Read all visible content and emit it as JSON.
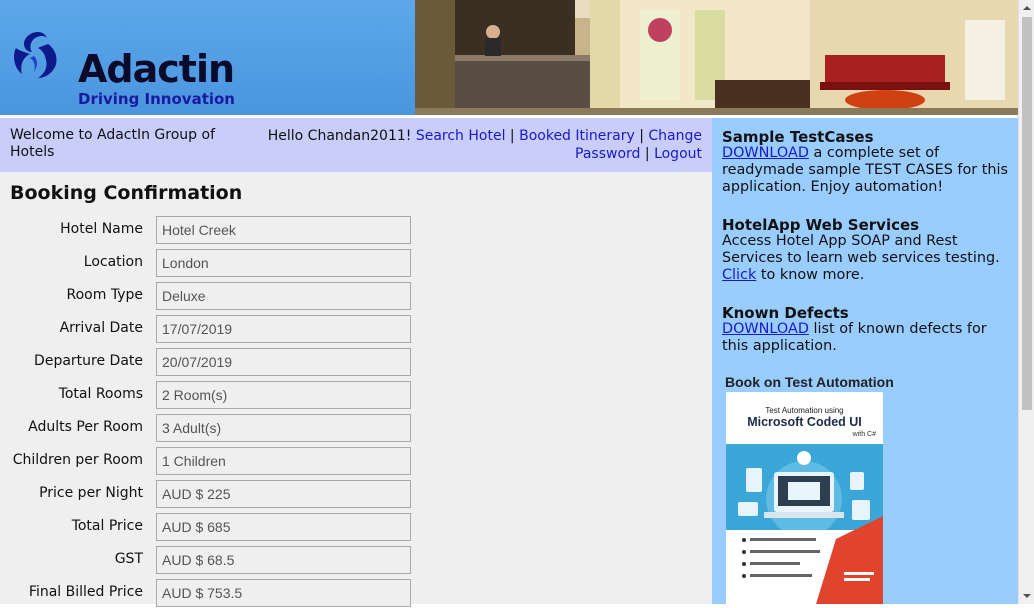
{
  "header": {
    "brand_name": "Adactin",
    "tagline": "Driving Innovation"
  },
  "welcome": {
    "text": "Welcome to AdactIn Group of Hotels",
    "greeting": "Hello Chandan2011!",
    "links": {
      "search_hotel": "Search Hotel",
      "booked_itinerary": "Booked Itinerary",
      "change_password": "Change Password",
      "logout": "Logout"
    },
    "separator": "|"
  },
  "main": {
    "title": "Booking Confirmation",
    "fields": [
      {
        "label": "Hotel Name",
        "value": "Hotel Creek"
      },
      {
        "label": "Location",
        "value": "London"
      },
      {
        "label": "Room Type",
        "value": "Deluxe"
      },
      {
        "label": "Arrival Date",
        "value": "17/07/2019"
      },
      {
        "label": "Departure Date",
        "value": "20/07/2019"
      },
      {
        "label": "Total Rooms",
        "value": "2 Room(s)"
      },
      {
        "label": "Adults Per Room",
        "value": "3 Adult(s)"
      },
      {
        "label": "Children per Room",
        "value": "1 Children"
      },
      {
        "label": "Price per Night",
        "value": "AUD $ 225"
      },
      {
        "label": "Total Price",
        "value": "AUD $ 685"
      },
      {
        "label": "GST",
        "value": "AUD $ 68.5"
      },
      {
        "label": "Final Billed Price",
        "value": "AUD $ 753.5"
      }
    ]
  },
  "sidebar": {
    "testcases": {
      "heading": "Sample TestCases",
      "link": "DOWNLOAD",
      "text": " a complete set of readymade sample TEST CASES for this application. Enjoy automation!"
    },
    "webservices": {
      "heading": "HotelApp Web Services",
      "text": "Access Hotel App SOAP and Rest Services to learn web services testing.",
      "link": "Click",
      "text_after": " to know more."
    },
    "defects": {
      "heading": "Known Defects",
      "link": "DOWNLOAD",
      "text": " list of known defects for this application."
    },
    "book": {
      "heading": "Book on Test Automation",
      "series": "Test Automation using",
      "title": "Microsoft Coded UI",
      "subtitle": "with C#"
    }
  },
  "colors": {
    "header_blue": "#4a95df",
    "welcome_bar": "#c8cdf9",
    "sidebar_blue": "#99ccff",
    "link": "#1a1acc"
  }
}
